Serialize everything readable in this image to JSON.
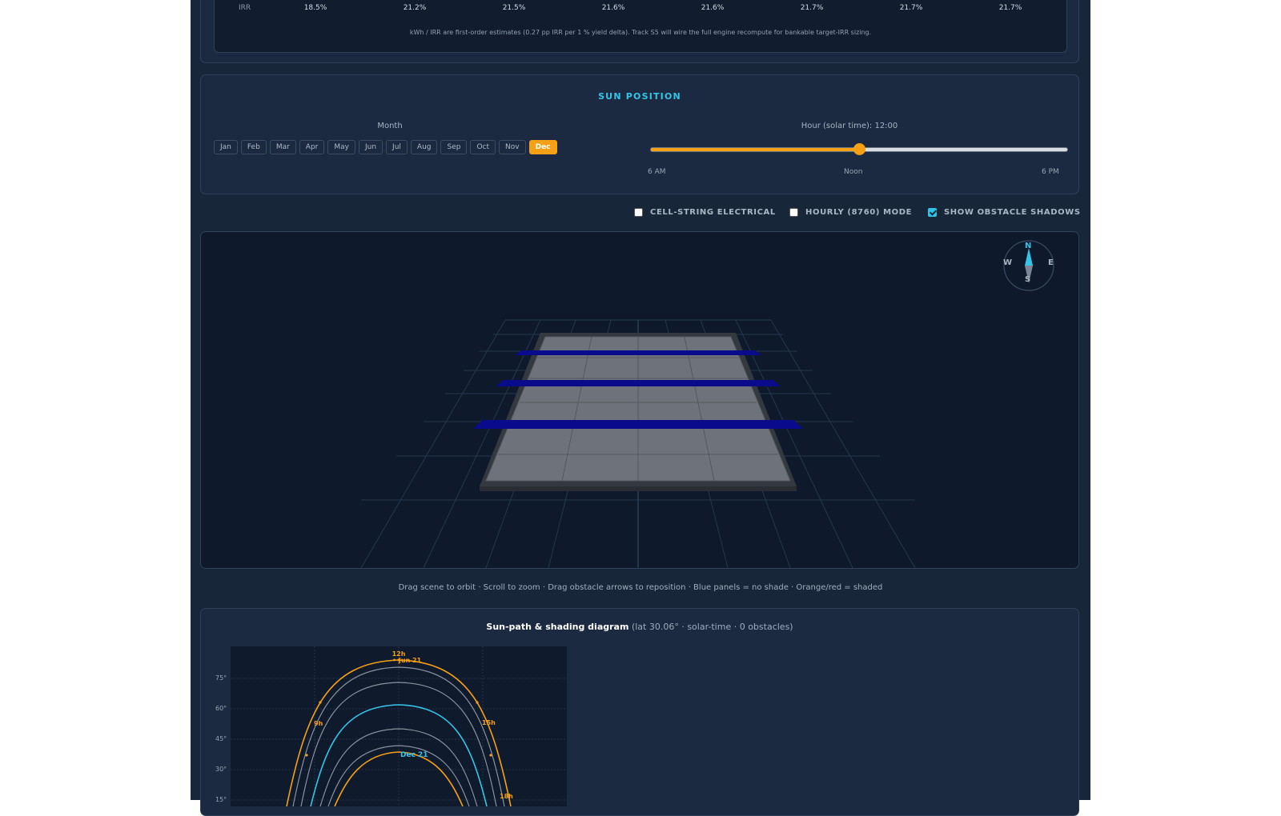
{
  "irr": {
    "label": "IRR",
    "values": [
      "18.5%",
      "21.2%",
      "21.5%",
      "21.6%",
      "21.6%",
      "21.7%",
      "21.7%",
      "21.7%"
    ],
    "note": "kWh / IRR are first-order estimates (0.27 pp IRR per 1 % yield delta). Track S5 will wire the full engine recompute for bankable target-IRR sizing."
  },
  "sun_position": {
    "title": "SUN POSITION",
    "month_label": "Month",
    "months": [
      "Jan",
      "Feb",
      "Mar",
      "Apr",
      "May",
      "Jun",
      "Jul",
      "Aug",
      "Sep",
      "Oct",
      "Nov",
      "Dec"
    ],
    "selected_month": "Dec",
    "hour_label": "Hour (solar time): 12:00",
    "hour_value_fraction": 0.5,
    "ticks": [
      "6 AM",
      "Noon",
      "6 PM"
    ]
  },
  "toggles": [
    {
      "label": "CELL-STRING ELECTRICAL",
      "checked": false
    },
    {
      "label": "HOURLY (8760) MODE",
      "checked": false
    },
    {
      "label": "SHOW OBSTACLE SHADOWS",
      "checked": true
    }
  ],
  "compass": {
    "n": "N",
    "s": "S",
    "e": "E",
    "w": "W"
  },
  "help_text": "Drag scene to orbit · Scroll to zoom · Drag obstacle arrows to reposition · Blue panels = no shade · Orange/red = shaded",
  "sun_path": {
    "title": "Sun-path & shading diagram",
    "subtitle": "(lat 30.06° · solar-time · 0 obstacles)",
    "y_ticks": [
      "75°",
      "60°",
      "45°",
      "30°",
      "15°"
    ],
    "labels": {
      "noon": "12h",
      "jun": "• Jun 21",
      "h9": "9h",
      "h15": "15h",
      "dec": "Dec 21",
      "h18": "18h"
    }
  },
  "colors": {
    "accent_cyan": "#35c4e8",
    "accent_orange": "#f5a015",
    "panel_blue": "#0a0a8c"
  }
}
